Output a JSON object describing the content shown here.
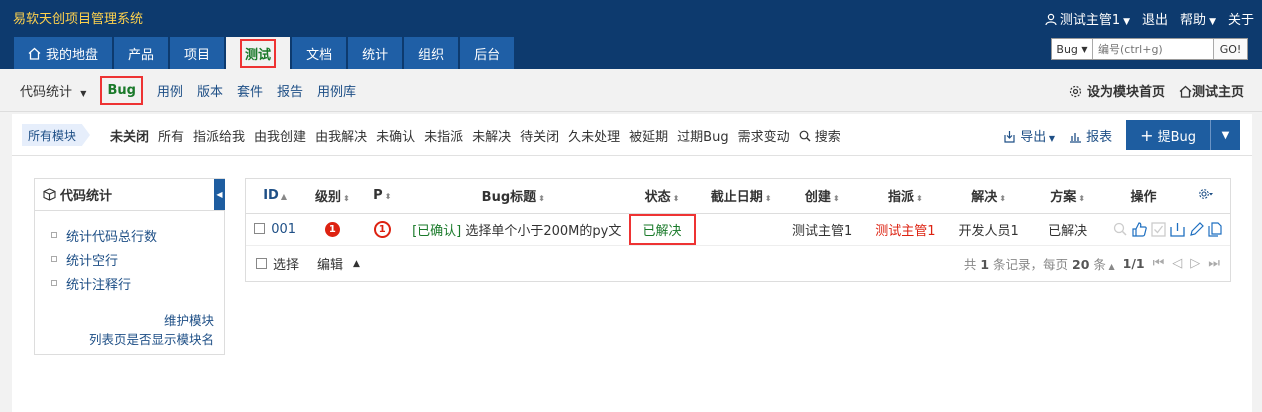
{
  "app": {
    "title": "易软天创项目管理系统"
  },
  "topbar": {
    "user": "测试主管1",
    "logout": "退出",
    "help": "帮助",
    "about": "关于"
  },
  "main_tabs": [
    {
      "label": "我的地盘",
      "icon": "home-icon"
    },
    {
      "label": "产品"
    },
    {
      "label": "项目"
    },
    {
      "label": "测试",
      "active": true
    },
    {
      "label": "文档"
    },
    {
      "label": "统计"
    },
    {
      "label": "组织"
    },
    {
      "label": "后台"
    }
  ],
  "search": {
    "type": "Bug",
    "placeholder": "编号(ctrl+g)",
    "go": "GO!"
  },
  "subnav": {
    "items": [
      "代码统计",
      "Bug",
      "用例",
      "版本",
      "套件",
      "报告",
      "用例库"
    ],
    "active": "Bug",
    "set_home": "设为模块首页",
    "test_home": "测试主页"
  },
  "filter": {
    "module": "所有模块",
    "items": [
      "未关闭",
      "所有",
      "指派给我",
      "由我创建",
      "由我解决",
      "未确认",
      "未指派",
      "未解决",
      "待关闭",
      "久未处理",
      "被延期",
      "过期Bug",
      "需求变动"
    ],
    "search": "搜索",
    "export": "导出",
    "report": "报表",
    "add_bug": "提Bug"
  },
  "side": {
    "title": "代码统计",
    "items": [
      "统计代码总行数",
      "统计空行",
      "统计注释行"
    ],
    "link1": "维护模块",
    "link2": "列表页是否显示模块名"
  },
  "table": {
    "headers": {
      "id": "ID",
      "severity": "级别",
      "pri": "P",
      "title": "Bug标题",
      "status": "状态",
      "deadline": "截止日期",
      "created": "创建",
      "assigned": "指派",
      "resolved": "解决",
      "resolution": "方案",
      "actions": "操作"
    },
    "rows": [
      {
        "id": "001",
        "severity": "1",
        "pri": "1",
        "confirmed": "[已确认]",
        "title": "选择单个小于200M的py文",
        "status": "已解决",
        "deadline": "",
        "created": "测试主管1",
        "assigned": "测试主管1",
        "resolved": "开发人员1",
        "resolution": "已解决"
      }
    ],
    "footer": {
      "select": "选择",
      "edit": "编辑",
      "pager_prefix": "共",
      "total": "1",
      "pager_mid": "条记录，每页",
      "per_page": "20",
      "pager_suffix": "条",
      "page": "1/1"
    }
  },
  "colors": {
    "header_bg": "#0d3a6e",
    "tab_bg": "#1f5fa6",
    "accent_green": "#1a7a2a",
    "highlight_red": "#e33",
    "title_yellow": "#ffd24d"
  }
}
